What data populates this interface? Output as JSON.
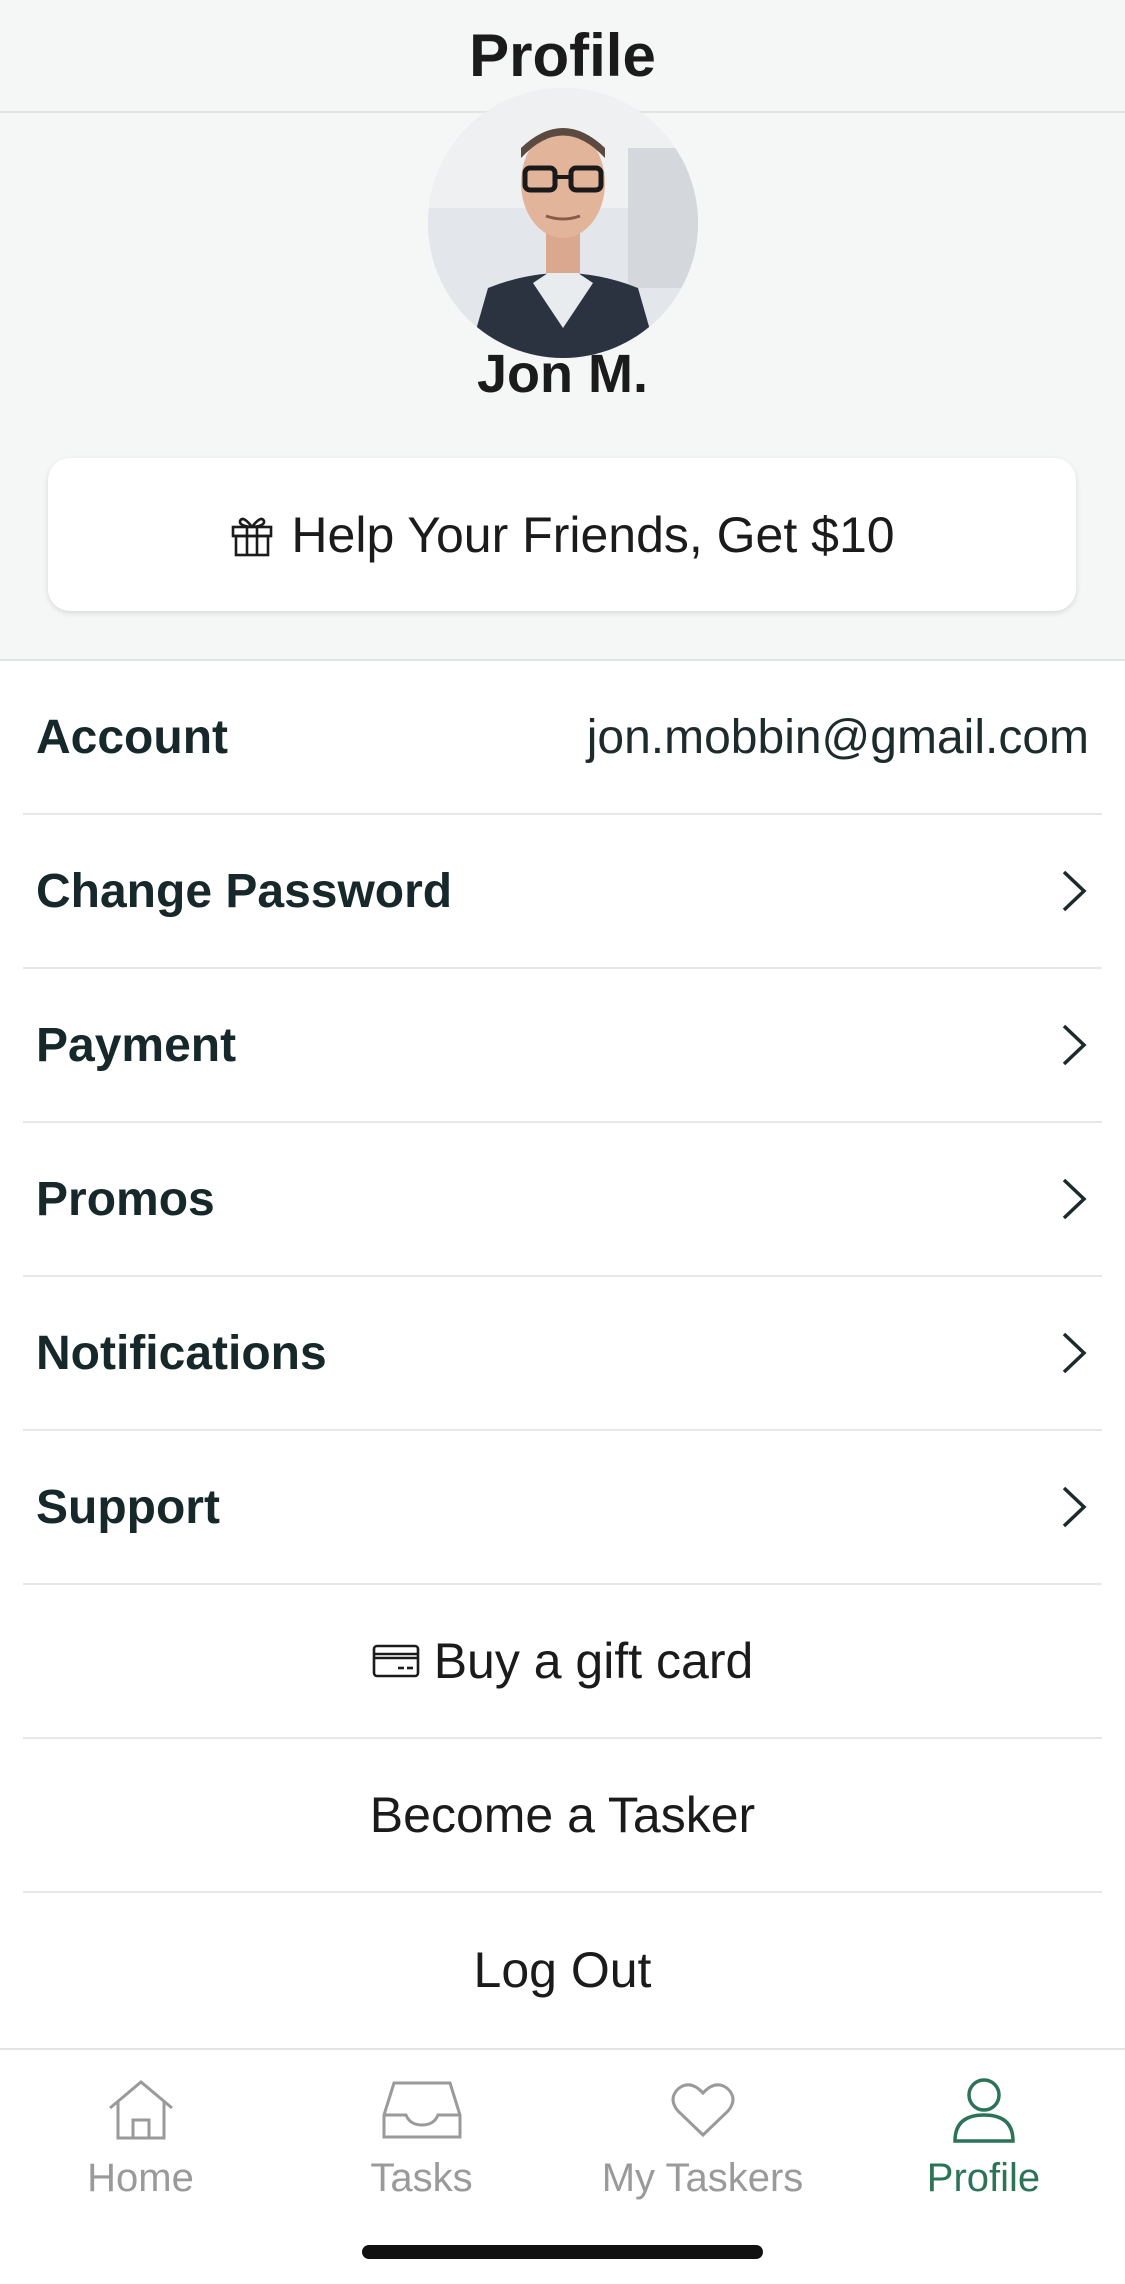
{
  "header": {
    "title": "Profile"
  },
  "profile": {
    "name": "Jon M.",
    "referral_label": "Help Your Friends, Get $10"
  },
  "menu": {
    "account_label": "Account",
    "account_email": "jon.mobbin@gmail.com",
    "items": [
      {
        "label": "Change Password",
        "icon": "chevron-right-icon"
      },
      {
        "label": "Payment",
        "icon": "chevron-right-icon"
      },
      {
        "label": "Promos",
        "icon": "chevron-right-icon"
      },
      {
        "label": "Notifications",
        "icon": "chevron-right-icon"
      },
      {
        "label": "Support",
        "icon": "chevron-right-icon"
      }
    ],
    "gift_card_label": "Buy a gift card",
    "become_tasker_label": "Become a Tasker",
    "logout_label": "Log Out"
  },
  "tabs": [
    {
      "label": "Home",
      "icon": "home-icon",
      "active": false
    },
    {
      "label": "Tasks",
      "icon": "inbox-tray-icon",
      "active": false
    },
    {
      "label": "My Taskers",
      "icon": "heart-icon",
      "active": false
    },
    {
      "label": "Profile",
      "icon": "person-icon",
      "active": true
    }
  ],
  "colors": {
    "accent": "#2c7357",
    "inactive_tab": "#9a9a9a",
    "header_bg": "#f5f6f6"
  }
}
